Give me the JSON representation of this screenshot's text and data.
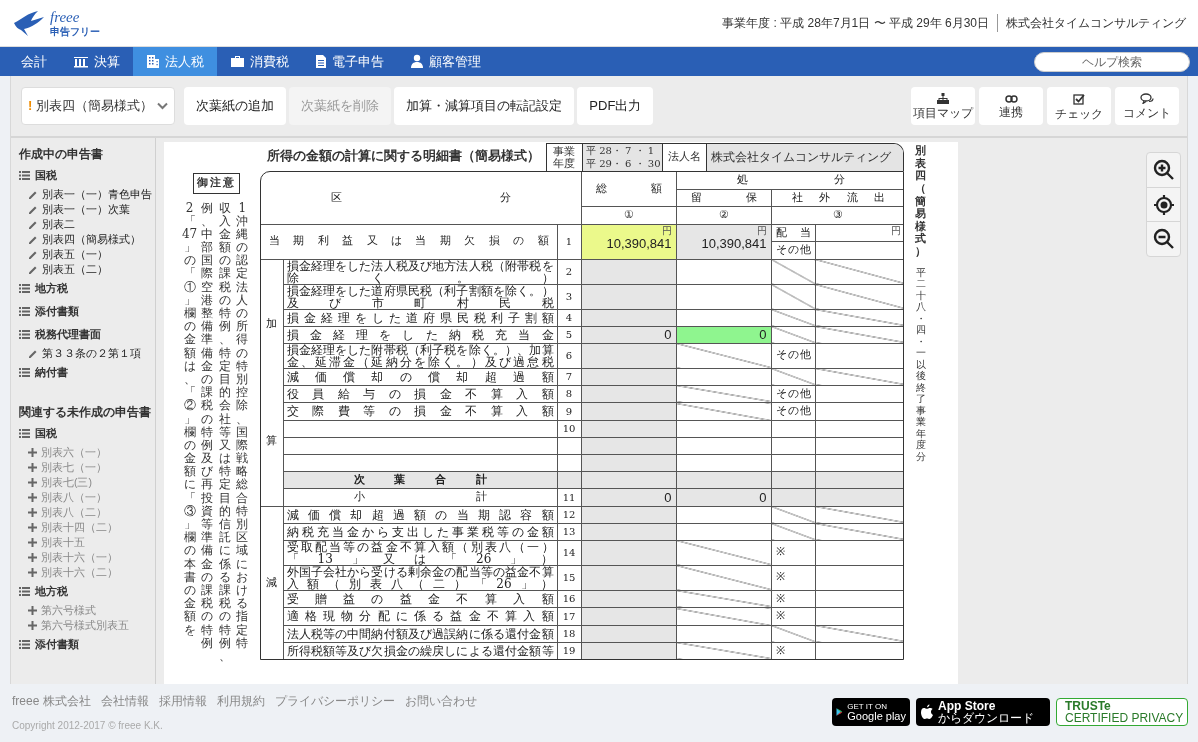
{
  "brand": {
    "name": "freee",
    "product": "申告フリー"
  },
  "header": {
    "fiscal_year": "事業年度 : 平成 28年7月1日 〜 平成 29年 6月30日",
    "company": "株式会社タイムコンサルティング"
  },
  "nav": {
    "items": [
      {
        "label": "会計",
        "selected": false
      },
      {
        "label": "決算",
        "selected": false
      },
      {
        "label": "法人税",
        "selected": true
      },
      {
        "label": "消費税",
        "selected": false
      },
      {
        "label": "電子申告",
        "selected": false
      },
      {
        "label": "顧客管理",
        "selected": false
      }
    ],
    "search": {
      "placeholder": "ヘルプ検索"
    }
  },
  "toolbar": {
    "form_select": {
      "marker": "!",
      "label": "別表四（簡易様式）"
    },
    "buttons": [
      {
        "label": "次葉紙の追加",
        "disabled": false
      },
      {
        "label": "次葉紙を削除",
        "disabled": true
      },
      {
        "label": "加算・減算項目の転記設定",
        "disabled": false
      },
      {
        "label": "PDF出力",
        "disabled": false
      }
    ],
    "tools": [
      {
        "label": "項目マップ"
      },
      {
        "label": "連携"
      },
      {
        "label": "チェック"
      },
      {
        "label": "コメント"
      }
    ]
  },
  "sidebar": {
    "sections": [
      {
        "title": "作成中の申告書",
        "kind": "created",
        "groups": [
          {
            "label": "国税",
            "children": [
              {
                "label": "別表一（一）青色申告"
              },
              {
                "label": "別表一（一）次葉"
              },
              {
                "label": "別表二"
              },
              {
                "label": "別表四（簡易様式）"
              },
              {
                "label": "別表五（一）"
              },
              {
                "label": "別表五（二）"
              }
            ]
          },
          {
            "label": "地方税"
          },
          {
            "label": "添付書類"
          },
          {
            "label": "税務代理書面",
            "children": [
              {
                "label": "第３３条の２第１項"
              }
            ]
          },
          {
            "label": "納付書"
          }
        ]
      },
      {
        "title": "関連する未作成の申告書",
        "kind": "missing",
        "groups": [
          {
            "label": "国税",
            "children": [
              {
                "label": "別表六（一）"
              },
              {
                "label": "別表七（一）"
              },
              {
                "label": "別表七(三)"
              },
              {
                "label": "別表八（一）"
              },
              {
                "label": "別表八（二）"
              },
              {
                "label": "別表十四（二）"
              },
              {
                "label": "別表十五"
              },
              {
                "label": "別表十六（一）"
              },
              {
                "label": "別表十六（二）"
              }
            ]
          },
          {
            "label": "地方税",
            "children": [
              {
                "label": "第六号様式"
              },
              {
                "label": "第六号様式別表五"
              }
            ]
          },
          {
            "label": "添付書類"
          }
        ]
      }
    ]
  },
  "form": {
    "title": "所得の金額の計算に関する明細書（簡易様式）",
    "period_label": "事業年度",
    "period": [
      "平 28・ 7 ・ 1",
      "平 29・ 6 ・ 30"
    ],
    "corp_label": "法人名",
    "corp_name": "株式会社タイムコンサルティング",
    "notice_title": "御注意",
    "notes": [
      "2　「47」の「①」欄の金額は、「②」欄の金額に「③」欄の本書の金額を",
      "例、中部国際空港整備準備金の課税の特例及び再投資等準備金の課税の特例",
      "収入金額の課税の特例、特定目的会社等又は特定目的信託に係る課税の特例、",
      "1　沖縄の認定法人の所得の特別控除、国際戦略総合特別区域における指定特"
    ],
    "side_title": "別表四（簡易様式）",
    "side_note": "平二十八・四・一以後終了事業年度分",
    "columns": {
      "category": "区分",
      "total": "総額",
      "disposal": "処分",
      "retained": "留保",
      "outflow": "社外流出",
      "total_mark": "①",
      "retained_mark": "②",
      "outflow_mark": "③"
    },
    "profit_row": {
      "no": "1",
      "label": "当期利益又は当期欠損の額",
      "total": {
        "value": "10,390,841",
        "unit": "円",
        "color": "#ebf98b"
      },
      "retained": {
        "value": "10,390,841",
        "unit": "円"
      },
      "outflow": [
        {
          "label": "配当",
          "unit": "円"
        },
        {
          "label": "その他"
        }
      ]
    },
    "sections": [
      {
        "labels": [
          "加",
          "算"
        ],
        "rows": [
          {
            "kind": "item",
            "no": "2",
            "label": "損金経理をした法人税及び地方法人税（附帯税を除く。）",
            "retained_na": false,
            "outflow_na": true
          },
          {
            "kind": "item",
            "no": "3",
            "label": "損金経理をした道府県民税（利子割額を除く。）及び市町村民税",
            "retained_na": false,
            "outflow_na": true
          },
          {
            "kind": "item",
            "no": "4",
            "label": "損金経理をした道府県民税利子割額",
            "retained_na": false,
            "outflow_na": true
          },
          {
            "kind": "item",
            "no": "5",
            "label": "損金経理をした納税充当金",
            "total": {
              "value": "0"
            },
            "retained": {
              "value": "0",
              "color": "#8ff58f"
            },
            "retained_na": false,
            "outflow_na": true
          },
          {
            "kind": "item",
            "no": "6",
            "label": "損金経理をした附帯税（利子税を除く。）、加算金、延滞金（延納分を除く。）及び過怠税",
            "retained_na": true,
            "outflow_label": "その他",
            "outflow_na": false
          },
          {
            "kind": "item",
            "no": "7",
            "label": "減価償却の償却超過額",
            "retained_na": false,
            "outflow_na": true
          },
          {
            "kind": "item",
            "no": "8",
            "label": "役員給与の損金不算入額",
            "retained_na": true,
            "outflow_label": "その他",
            "outflow_na": false
          },
          {
            "kind": "item",
            "no": "9",
            "label": "交際費等の損金不算入額",
            "retained_na": true,
            "outflow_label": "その他",
            "outflow_na": false
          },
          {
            "kind": "item",
            "no": "10",
            "retained_na": false,
            "outflow_na": false
          },
          {
            "kind": "item",
            "retained_na": false,
            "outflow_na": false
          },
          {
            "kind": "item",
            "retained_na": false,
            "outflow_na": false
          },
          {
            "kind": "sheet_total",
            "label": "次葉合計",
            "retained_na": false,
            "outflow_na": false
          },
          {
            "kind": "subtotal",
            "no": "11",
            "label": "小計",
            "total": {
              "value": "0"
            },
            "retained": {
              "value": "0"
            },
            "retained_na": false,
            "outflow_na": false
          }
        ]
      },
      {
        "labels": [
          "減"
        ],
        "rows": [
          {
            "kind": "item",
            "no": "12",
            "label": "減価償却超過額の当期認容額",
            "retained_na": false,
            "outflow_na": true
          },
          {
            "kind": "item",
            "no": "13",
            "label": "納税充当金から支出した事業税等の金額",
            "retained_na": false,
            "outflow_na": true
          },
          {
            "kind": "item",
            "no": "14",
            "label": "受取配当等の益金不算入額（別表八（一）「13」又は「26」）",
            "retained_na": true,
            "outflow_label": "※",
            "outflow_na": false
          },
          {
            "kind": "item",
            "no": "15",
            "label": "外国子会社から受ける剰余金の配当等の益金不算入額（別表八（二）「26」）",
            "retained_na": true,
            "outflow_label": "※",
            "outflow_na": false
          },
          {
            "kind": "item",
            "no": "16",
            "label": "受贈益の益金不算入額",
            "retained_na": true,
            "outflow_label": "※",
            "outflow_na": false
          },
          {
            "kind": "item",
            "no": "17",
            "label": "適格現物分配に係る益金不算入額",
            "retained_na": true,
            "outflow_label": "※",
            "outflow_na": false
          },
          {
            "kind": "item",
            "no": "18",
            "label": "法人税等の中間納付額及び過誤納に係る還付金額",
            "retained_na": false,
            "outflow_na": true
          },
          {
            "kind": "item",
            "no": "19",
            "label": "所得税額等及び欠損金の繰戻しによる還付金額等",
            "retained_na": true,
            "outflow_label": "※",
            "outflow_na": false
          }
        ]
      }
    ]
  },
  "footer": {
    "links": [
      "freee 株式会社",
      "会社情報",
      "採用情報",
      "利用規約",
      "プライバシーポリシー",
      "お問い合わせ"
    ],
    "copyright": "Copyright 2012-2017 © freee K.K.",
    "badges": [
      {
        "kind": "google_play",
        "lines": [
          "GET IT ON",
          "Google play"
        ]
      },
      {
        "kind": "app_store",
        "lines": [
          "App Store",
          "からダウンロード"
        ]
      },
      {
        "kind": "truste",
        "lines": [
          "TRUSTe",
          "CERTIFIED PRIVACY"
        ]
      }
    ]
  }
}
